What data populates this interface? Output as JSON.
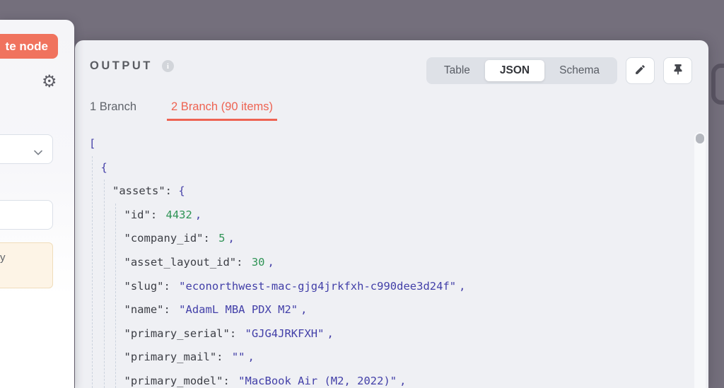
{
  "colors": {
    "accent": "#ee6352",
    "execute_button": "#f0735e",
    "canvas_background": "#746f7c",
    "json_key": "#3c3e45",
    "json_string": "#423fa8",
    "json_number": "#2e9355",
    "json_bracket": "#4540a8"
  },
  "left_panel": {
    "execute_button": "te node",
    "notice": "ut by"
  },
  "output": {
    "title": "OUTPUT",
    "views": [
      "Table",
      "JSON",
      "Schema"
    ],
    "active_view": "JSON",
    "tabs": [
      "1 Branch",
      "2 Branch (90 items)"
    ],
    "active_tab_index": 1
  },
  "json_viewer": {
    "lines": [
      {
        "i": 0,
        "toks": [
          [
            "b",
            "["
          ]
        ]
      },
      {
        "i": 1,
        "toks": [
          [
            "b",
            "{"
          ]
        ]
      },
      {
        "i": 2,
        "toks": [
          [
            "k",
            "\"assets\""
          ],
          [
            "p",
            ":"
          ],
          [
            "b",
            "{"
          ]
        ]
      },
      {
        "i": 3,
        "toks": [
          [
            "k",
            "\"id\""
          ],
          [
            "p",
            ":"
          ],
          [
            "n",
            "4432"
          ],
          [
            "c",
            ","
          ]
        ]
      },
      {
        "i": 3,
        "toks": [
          [
            "k",
            "\"company_id\""
          ],
          [
            "p",
            ":"
          ],
          [
            "n",
            "5"
          ],
          [
            "c",
            ","
          ]
        ]
      },
      {
        "i": 3,
        "toks": [
          [
            "k",
            "\"asset_layout_id\""
          ],
          [
            "p",
            ":"
          ],
          [
            "n",
            "30"
          ],
          [
            "c",
            ","
          ]
        ]
      },
      {
        "i": 3,
        "toks": [
          [
            "k",
            "\"slug\""
          ],
          [
            "p",
            ":"
          ],
          [
            "s",
            "\"econorthwest-mac-gjg4jrkfxh-c990dee3d24f\""
          ],
          [
            "c",
            ","
          ]
        ]
      },
      {
        "i": 3,
        "toks": [
          [
            "k",
            "\"name\""
          ],
          [
            "p",
            ":"
          ],
          [
            "s",
            "\"AdamL MBA PDX M2\""
          ],
          [
            "c",
            ","
          ]
        ]
      },
      {
        "i": 3,
        "toks": [
          [
            "k",
            "\"primary_serial\""
          ],
          [
            "p",
            ":"
          ],
          [
            "s",
            "\"GJG4JRKFXH\""
          ],
          [
            "c",
            ","
          ]
        ]
      },
      {
        "i": 3,
        "toks": [
          [
            "k",
            "\"primary_mail\""
          ],
          [
            "p",
            ":"
          ],
          [
            "s",
            "\"\""
          ],
          [
            "c",
            ","
          ]
        ]
      },
      {
        "i": 3,
        "toks": [
          [
            "k",
            "\"primary_model\""
          ],
          [
            "p",
            ":"
          ],
          [
            "s",
            "\"MacBook Air (M2, 2022)\""
          ],
          [
            "c",
            ","
          ]
        ]
      }
    ]
  }
}
